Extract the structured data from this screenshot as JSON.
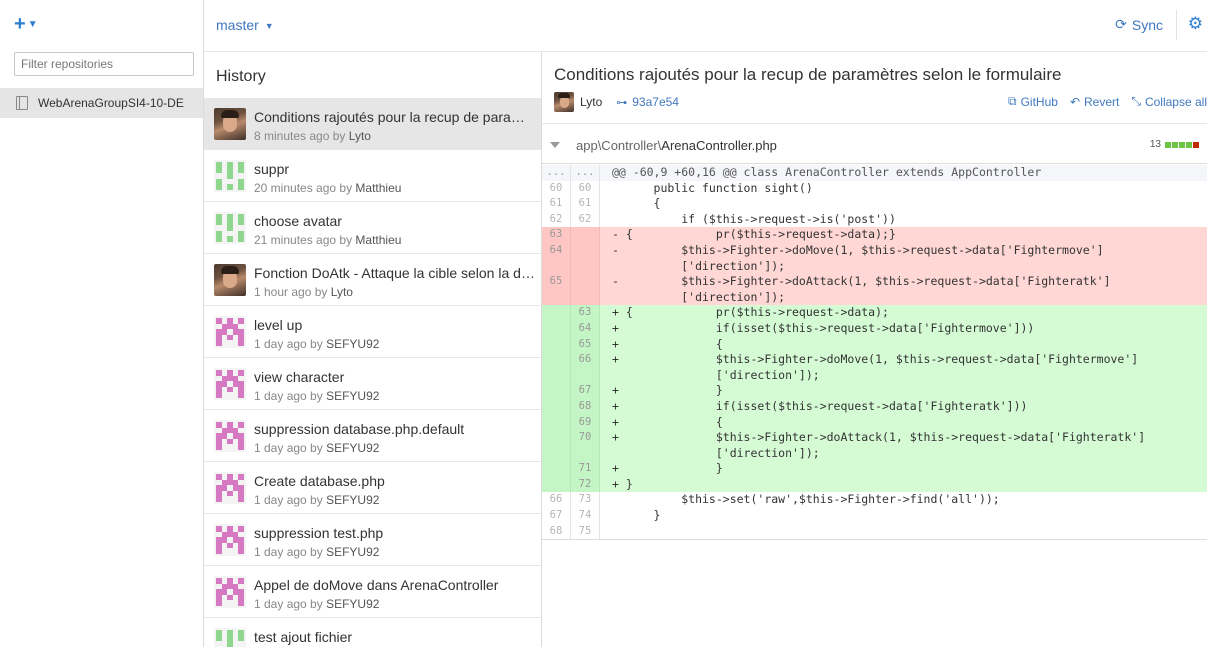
{
  "sidebar": {
    "add_label": "+",
    "filter_placeholder": "Filter repositories",
    "repo_name": "WebArenaGroupSI4-10-DE"
  },
  "topbar": {
    "branch": "master",
    "sync_label": "Sync"
  },
  "history": {
    "title": "History",
    "commits": [
      {
        "message": "Conditions rajoutés pour la recup de paramètres selon le formulaire",
        "time": "8 minutes ago by",
        "author": "Lyto",
        "avatar": "photo",
        "selected": true
      },
      {
        "message": "suppr",
        "time": "20 minutes ago by",
        "author": "Matthieu",
        "avatar": "green"
      },
      {
        "message": "choose avatar",
        "time": "21 minutes ago by",
        "author": "Matthieu",
        "avatar": "green"
      },
      {
        "message": "Fonction DoAtk - Attaque la cible selon la direction",
        "time": "1 hour ago by",
        "author": "Lyto",
        "avatar": "photo"
      },
      {
        "message": "level up",
        "time": "1 day ago by",
        "author": "SEFYU92",
        "avatar": "pink"
      },
      {
        "message": "view character",
        "time": "1 day ago by",
        "author": "SEFYU92",
        "avatar": "pink"
      },
      {
        "message": "suppression database.php.default",
        "time": "1 day ago by",
        "author": "SEFYU92",
        "avatar": "pink"
      },
      {
        "message": "Create database.php",
        "time": "1 day ago by",
        "author": "SEFYU92",
        "avatar": "pink"
      },
      {
        "message": "suppression test.php",
        "time": "1 day ago by",
        "author": "SEFYU92",
        "avatar": "pink"
      },
      {
        "message": "Appel de doMove dans ArenaController",
        "time": "1 day ago by",
        "author": "SEFYU92",
        "avatar": "pink"
      },
      {
        "message": "test ajout fichier",
        "time": "",
        "author": "",
        "avatar": "green"
      }
    ]
  },
  "detail": {
    "title": "Conditions rajoutés pour la recup de paramètres selon le formulaire",
    "author": "Lyto",
    "sha": "93a7e54",
    "actions": {
      "github": "GitHub",
      "revert": "Revert",
      "collapse": "Collapse all"
    },
    "file": {
      "dir": "app\\Controller\\",
      "name": "ArenaController.php",
      "changes": "13"
    },
    "colors": {
      "add": "#6cc644",
      "del": "#bd2c00",
      "add_bg": "#d5fbd5",
      "del_bg": "#ffd7d5"
    },
    "diff": [
      {
        "t": "hunk",
        "a": "...",
        "b": "...",
        "code": "@@ -60,9 +60,16 @@ class ArenaController extends AppController"
      },
      {
        "t": "ctx",
        "a": "60",
        "b": "60",
        "code": "      public function sight()"
      },
      {
        "t": "ctx",
        "a": "61",
        "b": "61",
        "code": "      {"
      },
      {
        "t": "ctx",
        "a": "62",
        "b": "62",
        "code": "          if ($this->request->is('post'))"
      },
      {
        "t": "del",
        "a": "63",
        "b": "",
        "code": "- {            pr($this->request->data);}"
      },
      {
        "t": "del",
        "a": "64",
        "b": "",
        "code": "-         $this->Fighter->doMove(1, $this->request->data['Fightermove']"
      },
      {
        "t": "del",
        "a": "",
        "b": "",
        "code": "          ['direction']);"
      },
      {
        "t": "del",
        "a": "65",
        "b": "",
        "code": "-         $this->Fighter->doAttack(1, $this->request->data['Fighteratk']"
      },
      {
        "t": "del",
        "a": "",
        "b": "",
        "code": "          ['direction']);"
      },
      {
        "t": "add",
        "a": "",
        "b": "63",
        "code": "+ {            pr($this->request->data);"
      },
      {
        "t": "add",
        "a": "",
        "b": "64",
        "code": "+              if(isset($this->request->data['Fightermove']))"
      },
      {
        "t": "add",
        "a": "",
        "b": "65",
        "code": "+              {"
      },
      {
        "t": "add",
        "a": "",
        "b": "66",
        "code": "+              $this->Fighter->doMove(1, $this->request->data['Fightermove']"
      },
      {
        "t": "add",
        "a": "",
        "b": "",
        "code": "               ['direction']);"
      },
      {
        "t": "add",
        "a": "",
        "b": "67",
        "code": "+              }"
      },
      {
        "t": "add",
        "a": "",
        "b": "68",
        "code": "+              if(isset($this->request->data['Fighteratk']))"
      },
      {
        "t": "add",
        "a": "",
        "b": "69",
        "code": "+              {"
      },
      {
        "t": "add",
        "a": "",
        "b": "70",
        "code": "+              $this->Fighter->doAttack(1, $this->request->data['Fighteratk']"
      },
      {
        "t": "add",
        "a": "",
        "b": "",
        "code": "               ['direction']);"
      },
      {
        "t": "add",
        "a": "",
        "b": "71",
        "code": "+              }"
      },
      {
        "t": "add",
        "a": "",
        "b": "72",
        "code": "+ }"
      },
      {
        "t": "ctx",
        "a": "66",
        "b": "73",
        "code": "          $this->set('raw',$this->Fighter->find('all'));"
      },
      {
        "t": "ctx",
        "a": "67",
        "b": "74",
        "code": "      }"
      },
      {
        "t": "ctx",
        "a": "68",
        "b": "75",
        "code": ""
      }
    ]
  }
}
